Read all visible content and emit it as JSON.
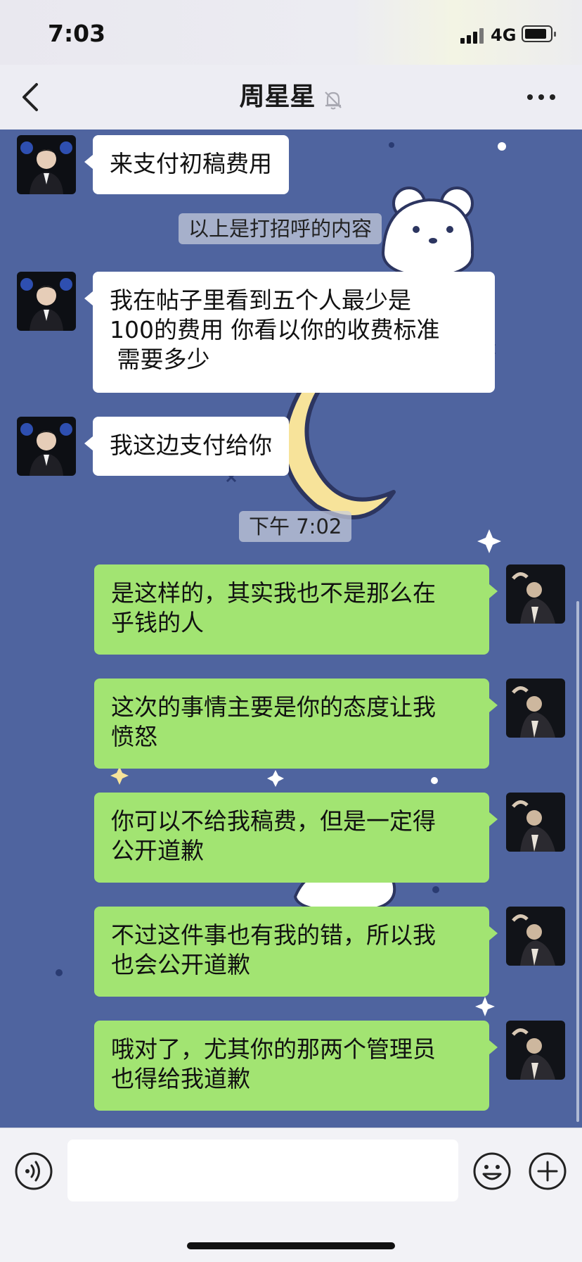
{
  "status_bar": {
    "time": "7:03",
    "network": "4G",
    "battery_level": 0.85
  },
  "header": {
    "title": "周星星",
    "muted_icon": "bell-slash-icon",
    "back_icon": "chevron-left-icon",
    "more_icon": "ellipsis-icon"
  },
  "chat": {
    "background_theme": "night sky with moon, stars and white bear",
    "messages": [
      {
        "sender": "contact",
        "text": "来支付初稿费用"
      },
      {
        "type": "system",
        "text": "以上是打招呼的内容"
      },
      {
        "sender": "contact",
        "text": "我在帖子里看到五个人最少是\n100的费用 你看以你的收费标准\n 需要多少"
      },
      {
        "sender": "contact",
        "text": "我这边支付给你"
      },
      {
        "type": "timestamp",
        "text": "下午 7:02"
      },
      {
        "sender": "me",
        "text": "是这样的，其实我也不是那么在\n乎钱的人"
      },
      {
        "sender": "me",
        "text": "这次的事情主要是你的态度让我\n愤怒"
      },
      {
        "sender": "me",
        "text": "你可以不给我稿费，但是一定得\n公开道歉"
      },
      {
        "sender": "me",
        "text": "不过这件事也有我的错，所以我\n也会公开道歉"
      },
      {
        "sender": "me",
        "text": "哦对了，尤其你的那两个管理员\n也得给我道歉"
      }
    ]
  },
  "input_bar": {
    "voice_icon": "voice-icon",
    "emoji_icon": "emoji-icon",
    "plus_icon": "plus-icon",
    "input_value": "",
    "placeholder": ""
  },
  "colors": {
    "chat_bg": "#4f649f",
    "outgoing_bubble": "#a2e472",
    "incoming_bubble": "#ffffff",
    "nav_bg": "#ededf3"
  }
}
